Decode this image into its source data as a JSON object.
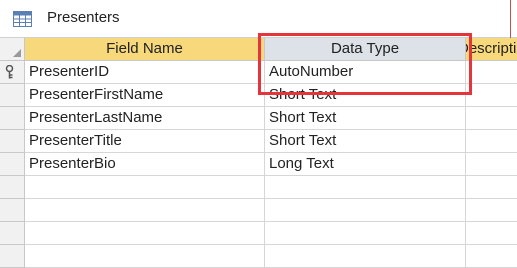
{
  "tab": {
    "title": "Presenters",
    "icon": "table-icon"
  },
  "columns": {
    "field_name": "Field Name",
    "data_type": "Data Type",
    "description": "Description"
  },
  "rows": [
    {
      "field": "PresenterID",
      "type": "AutoNumber",
      "primary_key": true
    },
    {
      "field": "PresenterFirstName",
      "type": "Short Text"
    },
    {
      "field": "PresenterLastName",
      "type": "Short Text"
    },
    {
      "field": "PresenterTitle",
      "type": "Short Text"
    },
    {
      "field": "PresenterBio",
      "type": "Long Text"
    }
  ],
  "colors": {
    "header_bg": "#f7d87b",
    "selected_header_bg": "#dde1e8",
    "highlight_border": "#e5343a"
  }
}
